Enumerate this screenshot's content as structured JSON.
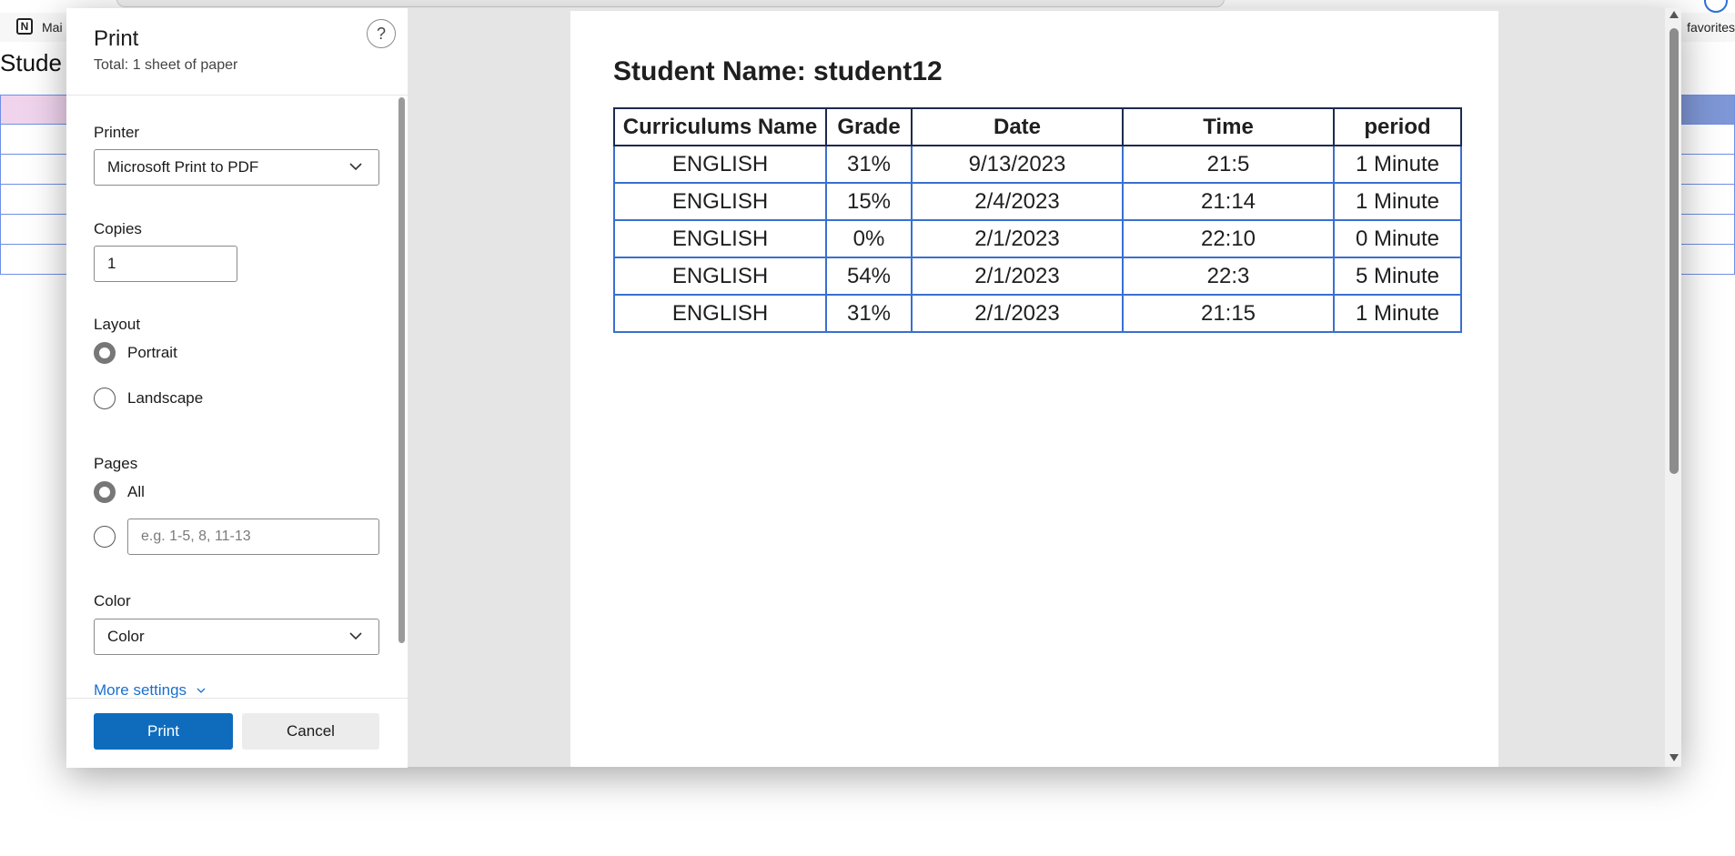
{
  "background_page": {
    "bookmark_label": "Mai",
    "favorites_label": "favorites",
    "heading_partial": "Stude",
    "notion_icon_letter": "N"
  },
  "dialog": {
    "title": "Print",
    "subtitle": "Total: 1 sheet of paper",
    "help_label": "?",
    "printer": {
      "label": "Printer",
      "value": "Microsoft Print to PDF"
    },
    "copies": {
      "label": "Copies",
      "value": "1"
    },
    "layout": {
      "label": "Layout",
      "options": [
        "Portrait",
        "Landscape"
      ],
      "selected": "Portrait"
    },
    "pages": {
      "label": "Pages",
      "all_label": "All",
      "selected": "All",
      "custom_placeholder": "e.g. 1-5, 8, 11-13"
    },
    "color": {
      "label": "Color",
      "value": "Color"
    },
    "more_settings_label": "More settings",
    "print_button": "Print",
    "cancel_button": "Cancel"
  },
  "preview": {
    "heading": "Student Name: student12",
    "table": {
      "columns": [
        "Curriculums Name",
        "Grade",
        "Date",
        "Time",
        "period"
      ],
      "rows": [
        [
          "ENGLISH",
          "31%",
          "9/13/2023",
          "21:5",
          "1 Minute"
        ],
        [
          "ENGLISH",
          "15%",
          "2/4/2023",
          "21:14",
          "1 Minute"
        ],
        [
          "ENGLISH",
          "0%",
          "2/1/2023",
          "22:10",
          "0 Minute"
        ],
        [
          "ENGLISH",
          "54%",
          "2/1/2023",
          "22:3",
          "5 Minute"
        ],
        [
          "ENGLISH",
          "31%",
          "2/1/2023",
          "21:15",
          "1 Minute"
        ]
      ]
    }
  },
  "colors": {
    "accent": "#0f6cbd",
    "table_border": "#3a6fd1",
    "header_border": "#1d2a4d",
    "dialog_bg": "#e5e5e5"
  }
}
